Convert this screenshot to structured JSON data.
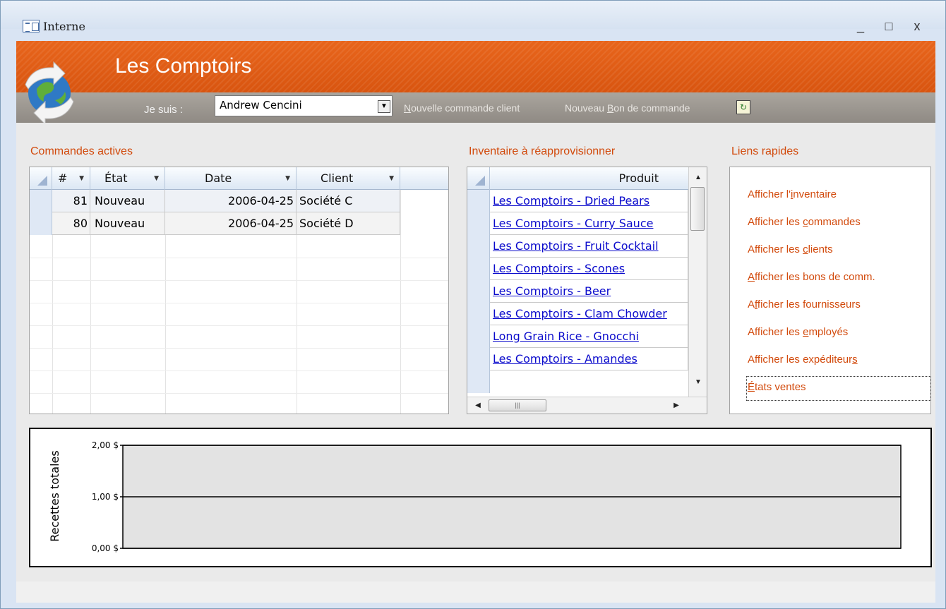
{
  "window": {
    "title": "Interne",
    "controls": [
      "_",
      "□",
      "x"
    ]
  },
  "header": {
    "title": "Les Comptoirs",
    "je_suis_label": "Je suis :",
    "user_value": "Andrew Cencini",
    "link_new_order_pre": "",
    "link_new_order_u": "N",
    "link_new_order_rest": "ouvelle commande client",
    "link_new_po_pre": "Nouveau ",
    "link_new_po_u": "B",
    "link_new_po_rest": "on de commande"
  },
  "orders": {
    "title": "Commandes actives",
    "columns": [
      "#",
      "État",
      "Date",
      "Client"
    ],
    "rows": [
      {
        "num": "81",
        "etat": "Nouveau",
        "date": "2006-04-25",
        "client": "Société C"
      },
      {
        "num": "80",
        "etat": "Nouveau",
        "date": "2006-04-25",
        "client": "Société D"
      }
    ]
  },
  "inventory": {
    "title": "Inventaire à réapprovisionner",
    "column": "Produit",
    "items": [
      "Les Comptoirs - Dried Pears",
      "Les Comptoirs - Curry Sauce",
      "Les Comptoirs - Fruit Cocktail",
      "Les Comptoirs - Scones",
      "Les Comptoirs - Beer",
      "Les Comptoirs - Clam Chowder",
      "Long Grain Rice - Gnocchi",
      "Les Comptoirs - Amandes"
    ]
  },
  "quick_links": {
    "title": "Liens rapides",
    "items": [
      {
        "pre": "Afficher l'",
        "u": "i",
        "rest": "nventaire"
      },
      {
        "pre": "Afficher les ",
        "u": "c",
        "rest": "ommandes"
      },
      {
        "pre": "Afficher les ",
        "u": "c",
        "rest": "lients"
      },
      {
        "pre": "",
        "u": "A",
        "rest": "fficher les bons de comm."
      },
      {
        "pre": "A",
        "u": "f",
        "rest": "ficher les fournisseurs"
      },
      {
        "pre": "Afficher les ",
        "u": "e",
        "rest": "mployés"
      },
      {
        "pre": "Afficher les expéditeur",
        "u": "s",
        "rest": ""
      },
      {
        "pre": "",
        "u": "É",
        "rest": "tats ventes"
      }
    ]
  },
  "chart_data": {
    "type": "bar",
    "title": "",
    "ylabel": "Recettes totales",
    "xlabel": "",
    "ylim": [
      0,
      2
    ],
    "yticks": [
      "0,00 $",
      "1,00 $",
      "2,00 $"
    ],
    "categories": [],
    "values": [],
    "grid": true
  },
  "colors": {
    "accent": "#d24a0c",
    "header_orange": "#e8651c",
    "link_blue": "#0b0bcc"
  }
}
